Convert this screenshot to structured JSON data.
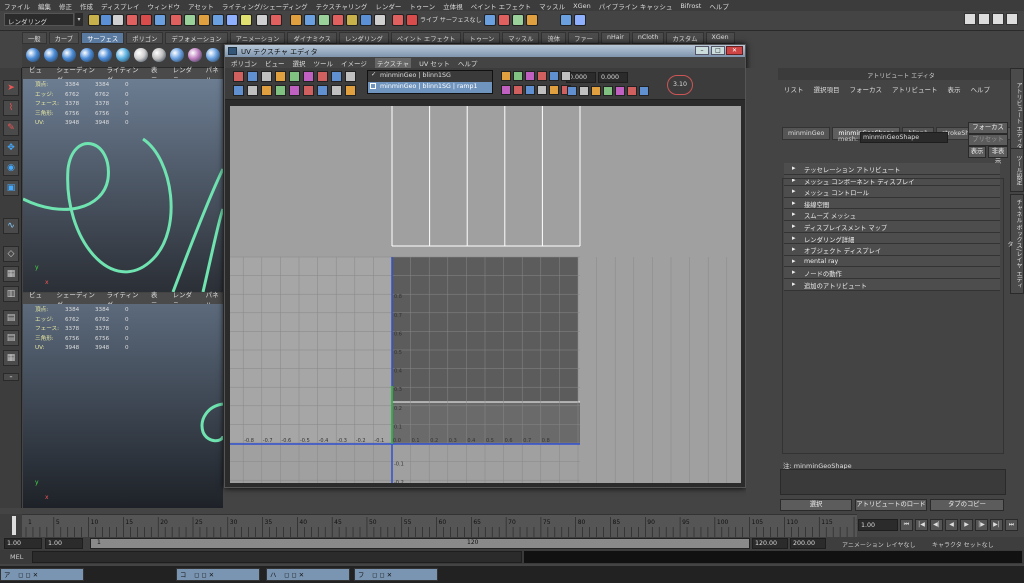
{
  "menubar": {
    "items": [
      "ファイル",
      "編集",
      "修正",
      "作成",
      "ディスプレイ",
      "ウィンドウ",
      "アセット",
      "ライティング/シェーディング",
      "テクスチャリング",
      "レンダー",
      "トゥーン",
      "立体視",
      "ペイント エフェクト",
      "マッスル",
      "XGen",
      "パイプライン キャッシュ",
      "Bifrost",
      "ヘルプ"
    ]
  },
  "toolbar": {
    "mode": "レンダリング",
    "snap_label": "ライブ サーフェスなし"
  },
  "shelf": {
    "tabs": [
      "一般",
      "カーブ",
      "サーフェス",
      "ポリゴン",
      "デフォメーション",
      "アニメーション",
      "ダイナミクス",
      "レンダリング",
      "ペイント エフェクト",
      "トゥーン",
      "マッスル",
      "流体",
      "ファー",
      "nHair",
      "nCloth",
      "カスタム",
      "XGen"
    ],
    "active": "サーフェス"
  },
  "viewport_top": {
    "menu": [
      "ビュー",
      "シェーディング",
      "ライティング",
      "表示",
      "レンダラ",
      "パネル"
    ]
  },
  "viewport_bottom": {
    "menu": [
      "ビュー",
      "シェーディング",
      "ライティング",
      "表示",
      "レンダラ",
      "パネル"
    ]
  },
  "hud": {
    "rows": [
      {
        "k": "頂点:",
        "a": "3384",
        "b": "3384",
        "c": "0"
      },
      {
        "k": "エッジ:",
        "a": "6762",
        "b": "6762",
        "c": "0"
      },
      {
        "k": "フェース:",
        "a": "3378",
        "b": "3378",
        "c": "0"
      },
      {
        "k": "三角形:",
        "a": "6756",
        "b": "6756",
        "c": "0"
      },
      {
        "k": "UV:",
        "a": "3948",
        "b": "3948",
        "c": "0"
      }
    ]
  },
  "axis": {
    "x": "x",
    "y": "y"
  },
  "uv_editor": {
    "title": "UV テクスチャ エディタ",
    "menu": [
      "ポリゴン",
      "ビュー",
      "選択",
      "ツール",
      "イメージ",
      "テクスチャ",
      "UV セット",
      "ヘルプ"
    ],
    "dropdown": [
      "minminGeo | blinn1SG",
      "minminGeo | blinn1SG | ramp1"
    ],
    "field1": "0.000",
    "field2": "0.000",
    "zoom": "3.10",
    "ticks_x": [
      "-0.8",
      "-0.7",
      "-0.6",
      "-0.5",
      "-0.4",
      "-0.3",
      "-0.2",
      "-0.1",
      "0.0",
      "0.1",
      "0.2",
      "0.3",
      "0.4",
      "0.5",
      "0.6",
      "0.7",
      "0.8"
    ],
    "ticks_y_pos": [
      "0.8",
      "0.7",
      "0.6",
      "0.5",
      "0.4",
      "0.3",
      "0.2",
      "0.1"
    ],
    "ticks_y_neg": [
      "-0.1",
      "-0.2",
      "-0.3",
      "-0.4",
      "-0.5"
    ]
  },
  "attr_editor": {
    "title": "アトリビュート エディタ",
    "menu": [
      "リスト",
      "選択項目",
      "フォーカス",
      "アトリビュート",
      "表示",
      "ヘルプ"
    ],
    "tabs": [
      "minminGeo",
      "minminGeoShape",
      "blinn1",
      "strokeShape1",
      "bn"
    ],
    "active_tab": "minminGeoShape",
    "mesh_label": "mesh:",
    "mesh_value": "minminGeoShape",
    "focus_btn": "フォーカス",
    "preset_btn": "プリセット",
    "show_btn": "表示",
    "hide_btn": "非表示",
    "sections": [
      "テッセレーション アトリビュート",
      "メッシュ コンポーネント ディスプレイ",
      "メッシュ コントロール",
      "接線空間",
      "スムーズ メッシュ",
      "ディスプレイスメント マップ",
      "レンダリング詳細",
      "オブジェクト ディスプレイ",
      "mental ray",
      "ノードの動作",
      "追加のアトリビュート"
    ],
    "notes_label": "注: minminGeoShape",
    "select_btn": "選択",
    "load_btn": "アトリビュートのロード",
    "copy_btn": "タブのコピー",
    "side_tabs": [
      "アトリビュート エディタ",
      "ツール設定",
      "チャネル ボックス/レイヤ エディタ"
    ]
  },
  "timeline": {
    "ticks": [
      "1",
      "5",
      "10",
      "15",
      "20",
      "25",
      "30",
      "35",
      "40",
      "45",
      "50",
      "55",
      "60",
      "65",
      "70",
      "75",
      "80",
      "85",
      "90",
      "95",
      "100",
      "105",
      "110",
      "115",
      "120"
    ],
    "current": "1.00"
  },
  "range": {
    "start": "1.00",
    "start2": "1.00",
    "inner_start": "1",
    "inner_end": "120",
    "end": "120.00",
    "end2": "200.00",
    "anim_layer": "アニメーション レイヤなし",
    "char_set": "キャラクタ セットなし"
  },
  "mel": {
    "label": "MEL"
  },
  "taskbar": {
    "items": [
      "ア",
      "コ",
      "ハ",
      "フ"
    ]
  }
}
